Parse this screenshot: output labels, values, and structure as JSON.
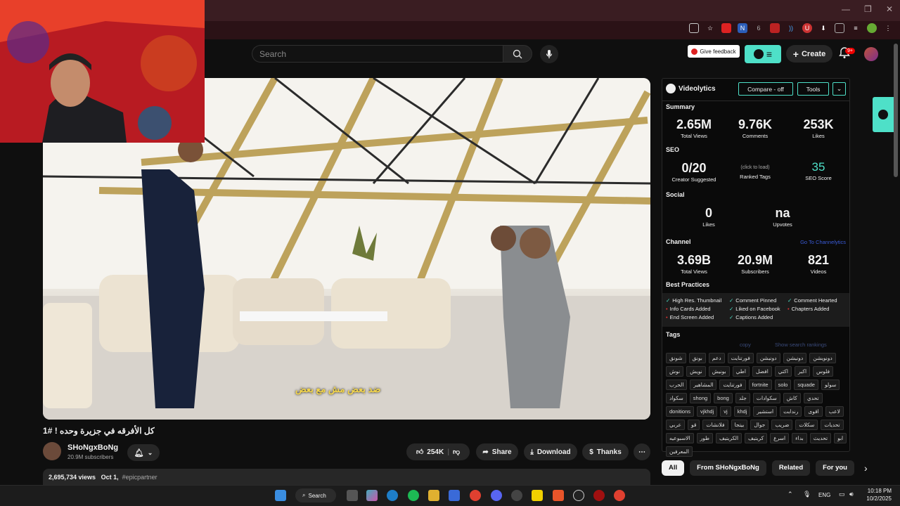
{
  "browser": {
    "minimize": "—",
    "restore": "❐",
    "close": "✕"
  },
  "header": {
    "search_placeholder": "Search",
    "feedback": "Give feedback",
    "create": "Create",
    "notif_count": "9+"
  },
  "video": {
    "subtitle": "ضد بعض مش مع بعض",
    "title": "كل الأفرقه في جزيرة وحده ! #1",
    "channel": "SHoNgxBoNg",
    "subscribers": "20.9M subscribers"
  },
  "actions": {
    "likes": "254K",
    "share": "Share",
    "download": "Download",
    "thanks": "Thanks",
    "more": "⋯"
  },
  "description": {
    "views": "2,695,734 views",
    "date": "Oct 1,",
    "hashtag": "#epicpartner"
  },
  "videolytics": {
    "brand": "Videolytics",
    "compare": "Compare - off",
    "tools": "Tools",
    "chevron": "⌄",
    "summary": {
      "heading": "Summary",
      "stats": [
        {
          "value": "2.65M",
          "label": "Total Views"
        },
        {
          "value": "9.76K",
          "label": "Comments"
        },
        {
          "value": "253K",
          "label": "Likes"
        }
      ]
    },
    "seo": {
      "heading": "SEO",
      "creator": {
        "value": "0/20",
        "label": "Creator Suggested"
      },
      "ranked": {
        "value": "(click to load)",
        "label": "Ranked Tags"
      },
      "score": {
        "value": "35",
        "label": "SEO Score"
      }
    },
    "social": {
      "heading": "Social",
      "likes": {
        "value": "0",
        "label": "Likes"
      },
      "upvotes": {
        "value": "na",
        "label": "Upvotes"
      }
    },
    "channel": {
      "heading": "Channel",
      "link": "Go To Channelytics",
      "stats": [
        {
          "value": "3.69B",
          "label": "Total Views"
        },
        {
          "value": "20.9M",
          "label": "Subscribers"
        },
        {
          "value": "821",
          "label": "Videos"
        }
      ]
    },
    "best_practices": {
      "heading": "Best Practices",
      "items": [
        {
          "label": "High Res. Thumbnail",
          "ok": true
        },
        {
          "label": "Comment Pinned",
          "ok": true
        },
        {
          "label": "Comment Hearted",
          "ok": true
        },
        {
          "label": "Info Cards Added",
          "ok": false
        },
        {
          "label": "Liked on Facebook",
          "ok": true
        },
        {
          "label": "Chapters Added",
          "ok": false
        },
        {
          "label": "End Screen Added",
          "ok": false
        },
        {
          "label": "Captions Added",
          "ok": true
        }
      ]
    },
    "tags": {
      "heading": "Tags",
      "copy": "copy",
      "show_rankings": "Show search rankings",
      "items": [
        "شونق",
        "بونق",
        "دعم",
        "فورتنايت",
        "دونيشن",
        "دونيشن",
        "دونويشن",
        "نوش",
        "نويش",
        "بونيش",
        "اطي",
        "افضل",
        "اكتي",
        "اكبر",
        "فلوس",
        "الحرب",
        "المشاهير",
        "فورتنايت",
        "fortnite",
        "solo",
        "squade",
        "سولو",
        "سكواد",
        "shong",
        "bong",
        "جلد",
        "سكوادات",
        "كاش",
        "تحدي",
        "donitions",
        "vjkhdj",
        "vj",
        "khdj",
        "استشير",
        "رندابت",
        "اقوى",
        "لاعب",
        "عربي",
        "قو",
        "فلانشات",
        "بيتجا",
        "جوال",
        "ضريب",
        "سكلات",
        "تحديات",
        "الاسبوعيه",
        "طور",
        "الكريتيف",
        "كريتيف",
        "اسرع",
        "بداء",
        "تحديث",
        "ابو",
        "المعرفين"
      ]
    }
  },
  "chips": [
    "All",
    "From SHoNgxBoNg",
    "Related",
    "For you"
  ],
  "taskbar": {
    "search": "Search",
    "lang": "ENG",
    "time": "10:18 PM",
    "date": "10/2/2025"
  }
}
